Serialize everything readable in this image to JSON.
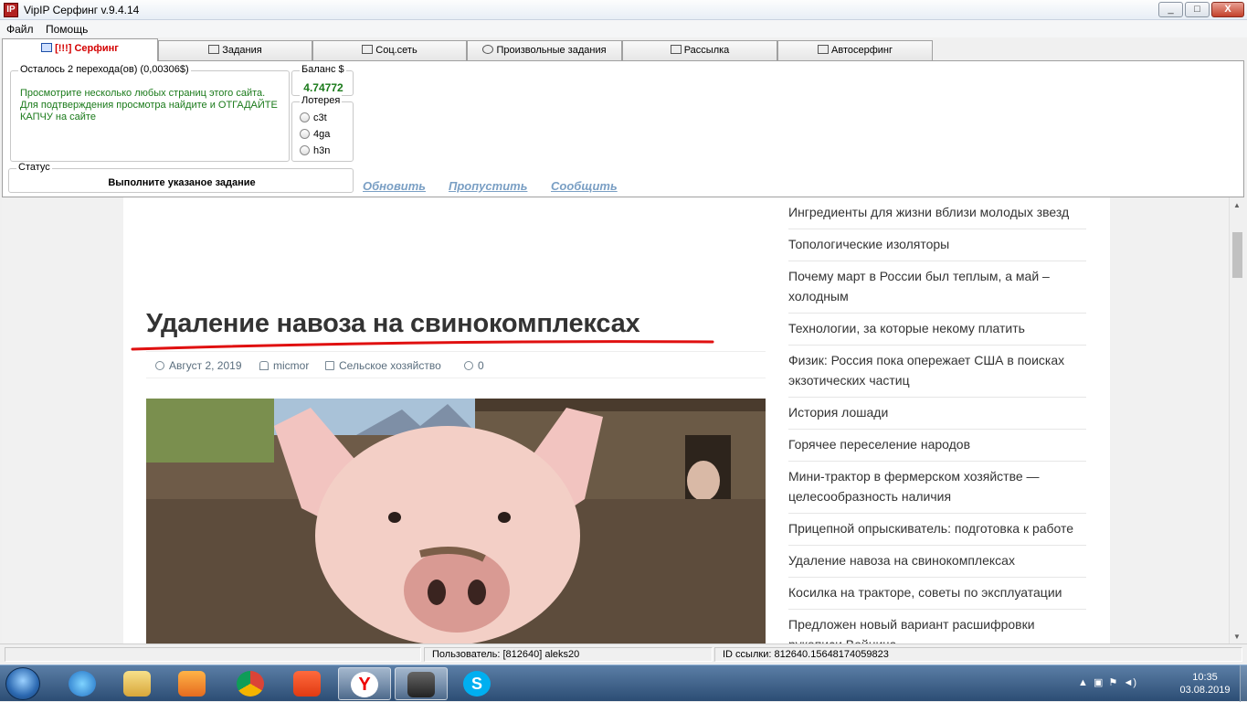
{
  "window": {
    "title": "VipIP Серфинг  v.9.4.14",
    "app_icon": "IP",
    "min": "_",
    "max": "□",
    "close": "X"
  },
  "menu": [
    "Файл",
    "Помощь"
  ],
  "tabs": [
    "[!!!] Серфинг",
    "Задания",
    "Соц.сеть",
    "Произвольные задания",
    "Рассылка",
    "Автосерфинг"
  ],
  "task": {
    "title": "Осталось 2 перехода(ов) (0,00306$)",
    "text": "Просмотрите несколько любых страниц этого сайта. Для подтверждения просмотра найдите и ОТГАДАЙТЕ КАПЧУ на сайте"
  },
  "balance": {
    "label": "Баланс $",
    "value": "4.74772"
  },
  "lottery": {
    "label": "Лотерея",
    "options": [
      "c3t",
      "4ga",
      "h3n"
    ]
  },
  "status": {
    "label": "Статус",
    "text": "Выполните указаное задание"
  },
  "links": {
    "refresh": "Обновить",
    "skip": "Пропустить",
    "report": "Сообщить"
  },
  "article": {
    "title": "Удаление навоза на свинокомплексах",
    "date": "Август 2, 2019",
    "author": "micmor",
    "category": "Сельское хозяйство",
    "comments": "0"
  },
  "sidebar": [
    "Ингредиенты для жизни вблизи молодых звезд",
    "Топологические изоляторы",
    "Почему март в России был теплым, а май – холодным",
    "Технологии, за которые некому платить",
    "Физик: Россия пока опережает США в поисках экзотических частиц",
    "История лошади",
    "Горячее переселение народов",
    "Мини-трактор в фермерском хозяйстве — целесообразность наличия",
    "Прицепной опрыскиватель: подготовка к работе",
    "Удаление навоза на свинокомплексах",
    "Косилка на тракторе, советы по эксплуатации",
    "Предложен новый вариант расшифровки рукописи Войнича"
  ],
  "statusbar": {
    "user": "Пользователь: [812640] aleks20",
    "link_id": "ID ссылки: 812640.15648174059823"
  },
  "taskbar": {
    "apps": [
      "internet-explorer",
      "file-explorer",
      "media-player",
      "chrome",
      "brave",
      "yandex",
      "vpn-client",
      "skype"
    ],
    "time": "10:35",
    "date": "03.08.2019"
  }
}
